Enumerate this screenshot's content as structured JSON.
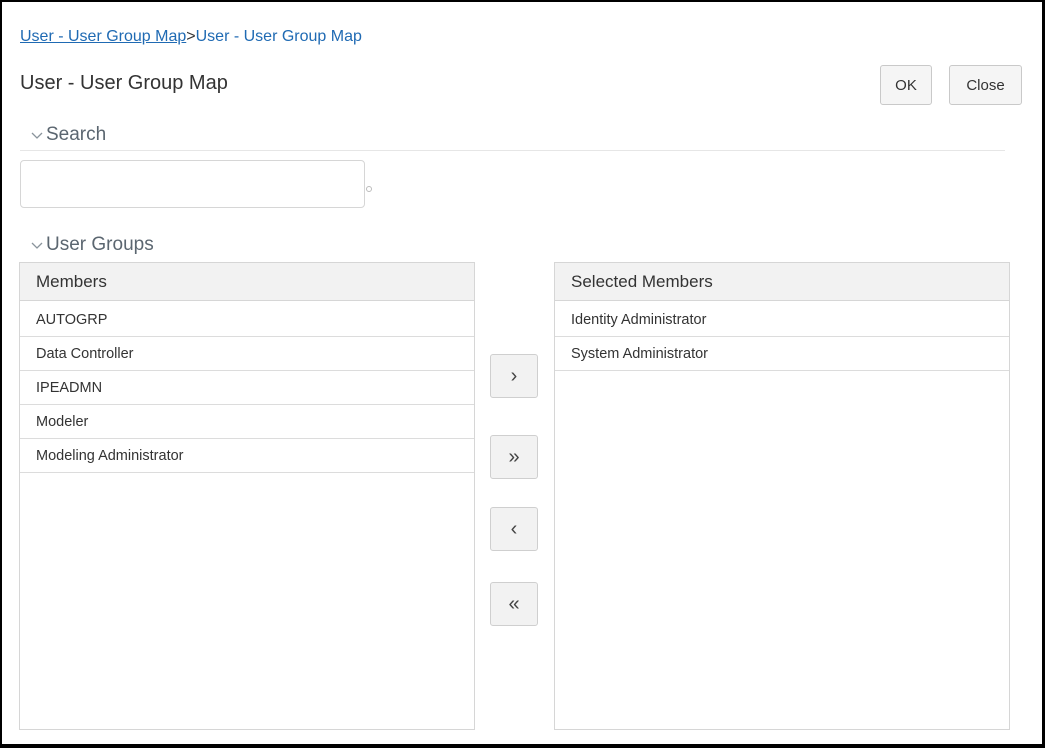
{
  "breadcrumb": {
    "link": "User - User Group Map",
    "separator": ">",
    "current": "User - User Group Map"
  },
  "page": {
    "title": "User - User Group Map"
  },
  "actions": {
    "ok_label": "OK",
    "close_label": "Close"
  },
  "search": {
    "header": "Search",
    "value": "",
    "placeholder": ""
  },
  "user_groups": {
    "header": "User Groups",
    "members_header": "Members",
    "selected_header": "Selected Members",
    "members": [
      "AUTOGRP",
      "Data Controller",
      "IPEADMN",
      "Modeler",
      "Modeling Administrator"
    ],
    "selected": [
      "Identity Administrator",
      "System Administrator"
    ],
    "move_buttons": {
      "move_right": "›",
      "move_all_right": "»",
      "move_left": "‹",
      "move_all_left": "«"
    }
  },
  "icons": {
    "section_toggle": "chevron-down-icon"
  },
  "colors": {
    "link": "#1f6ab3",
    "section_header": "#5b6670",
    "panel_header_bg": "#f2f2f2",
    "border": "#d6d6d6"
  }
}
